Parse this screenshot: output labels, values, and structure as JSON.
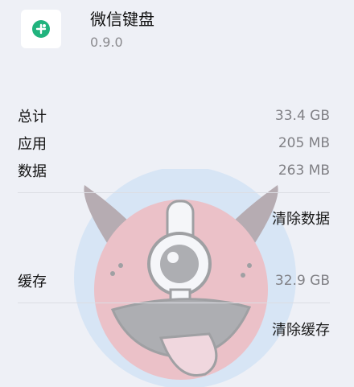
{
  "app": {
    "icon": "wetype-keyboard-icon",
    "name": "微信键盘",
    "version": "0.9.0"
  },
  "storage": {
    "total_label": "总计",
    "total_value": "33.4 GB",
    "app_label": "应用",
    "app_value": "205 MB",
    "data_label": "数据",
    "data_value": "263 MB",
    "clear_data": "清除数据",
    "cache_label": "缓存",
    "cache_value": "32.9 GB",
    "clear_cache": "清除缓存"
  },
  "colors": {
    "background": "#eef0f6",
    "icon_green": "#20b37d",
    "value_gray": "#808085"
  },
  "watermark": {
    "icon": "horned-monster-sticker"
  }
}
